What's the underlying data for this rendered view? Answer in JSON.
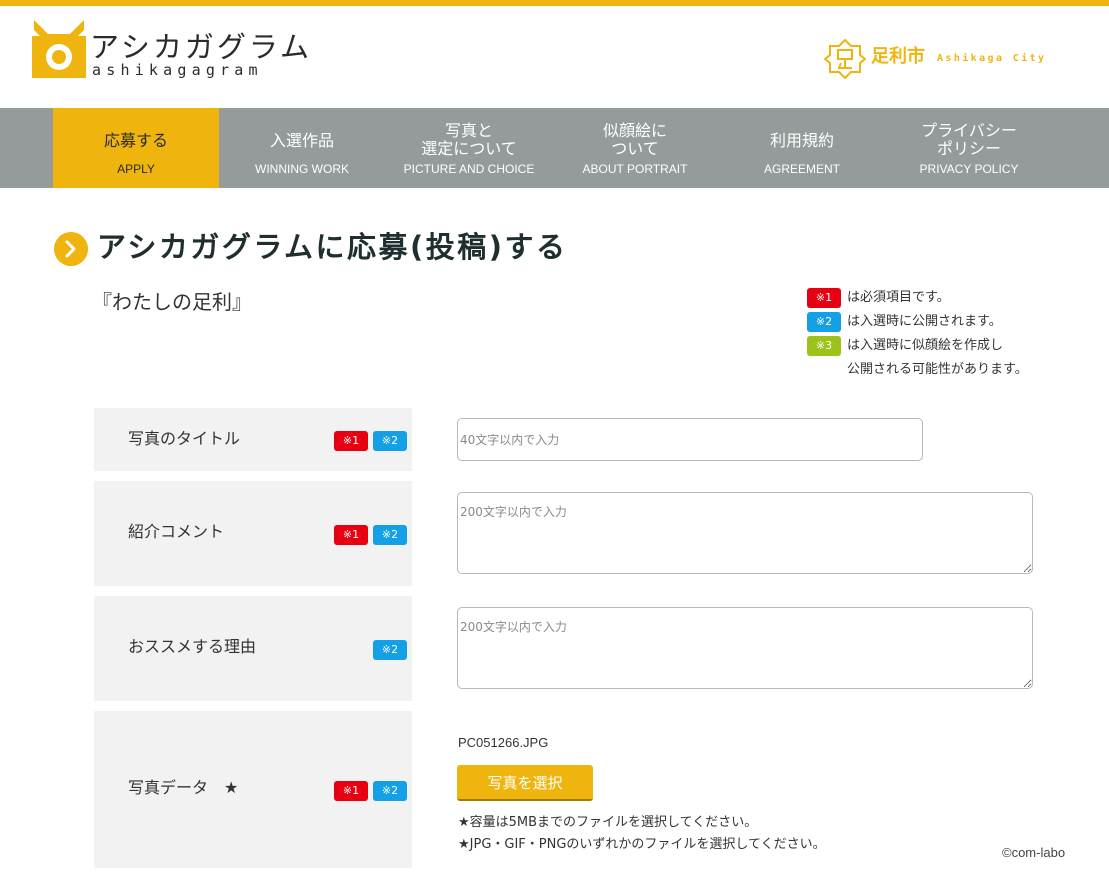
{
  "header": {
    "logo_title": "アシカガグラム",
    "logo_sub": "ashikagagram",
    "city_name": "足利市",
    "city_name_en": "Ashikaga City"
  },
  "nav": [
    {
      "jp": "応募する",
      "en": "APPLY",
      "active": true
    },
    {
      "jp": "入選作品",
      "en": "WINNING WORK"
    },
    {
      "jp1": "写真と",
      "jp2": "選定について",
      "en": "PICTURE AND CHOICE"
    },
    {
      "jp1": "似顔絵に",
      "jp2": "ついて",
      "en": "ABOUT PORTRAIT"
    },
    {
      "jp": "利用規約",
      "en": "AGREEMENT"
    },
    {
      "jp1": "プライバシー",
      "jp2": "ポリシー",
      "en": "PRIVACY POLICY"
    }
  ],
  "page": {
    "title": "アシカガグラムに応募(投稿)する",
    "subtitle": "『わたしの足利』"
  },
  "legend": {
    "badge1": "※1",
    "text1": "は必須項目です。",
    "badge2": "※2",
    "text2": "は入選時に公開されます。",
    "badge3": "※3",
    "text3a": "は入選時に似顔絵を作成し",
    "text3b": "公開される可能性があります。"
  },
  "colors": {
    "accent": "#f0b40f",
    "nav_bg": "#959a9b",
    "required": "#e60012",
    "public": "#14a0e6",
    "portrait": "#9cc31a"
  },
  "form": {
    "title": {
      "label": "写真のタイトル",
      "badge1": "※1",
      "badge2": "※2",
      "placeholder": "40文字以内で入力",
      "value": ""
    },
    "comment": {
      "label": "紹介コメント",
      "badge1": "※1",
      "badge2": "※2",
      "placeholder": "200文字以内で入力",
      "value": ""
    },
    "reason": {
      "label": "おススメする理由",
      "badge2": "※2",
      "placeholder": "200文字以内で入力",
      "value": ""
    },
    "photo": {
      "label": "写真データ　★",
      "badge1": "※1",
      "badge2": "※2",
      "filename": "PC051266.JPG",
      "button": "写真を選択",
      "note1": "★容量は5MBまでのファイルを選択してください。",
      "note2": "★JPG・GIF・PNGのいずれかのファイルを選択してください。"
    }
  },
  "footer": {
    "copyright": "©com-labo"
  }
}
